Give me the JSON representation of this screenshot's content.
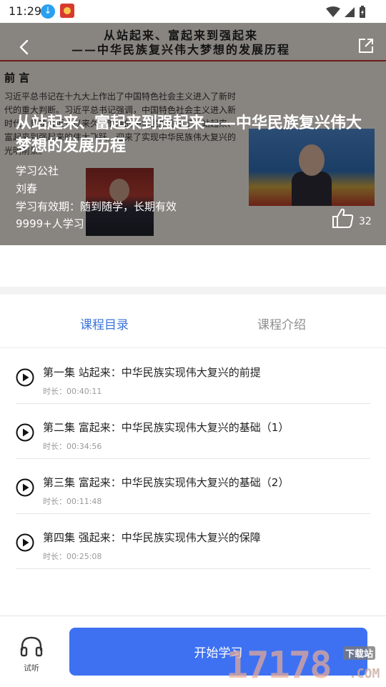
{
  "status_bar": {
    "time": "11:29"
  },
  "hero": {
    "doc_banner_line1": "从站起来、富起来到强起来",
    "doc_banner_line2": "——中华民族复兴伟大梦想的发展历程",
    "doc_heading": "前 言",
    "doc_text": "习近平总书记在十九大上作出了中国特色社会主义进入了新时代的重大判断。习近平总书记强调，中国特色社会主义进入新时代，意味着近代以来久经磨难的中华民族迎来了从站起来、富起来到强起来的伟大飞跃，迎来了实现中华民族伟大复兴的光明前景。",
    "title": "从站起来、富起来到强起来——中华民族复兴伟大梦想的发展历程",
    "publisher": "学习公社",
    "author": "刘春",
    "validity": "学习有效期：随到随学，长期有效",
    "learners": "9999+人学习",
    "likes": "32"
  },
  "tabs": [
    {
      "label": "课程目录",
      "active": true
    },
    {
      "label": "课程介绍",
      "active": false
    }
  ],
  "episodes": [
    {
      "title": "第一集 站起来：中华民族实现伟大复兴的前提",
      "duration": "时长：00:40:11"
    },
    {
      "title": "第二集 富起来：中华民族实现伟大复兴的基础（1）",
      "duration": "时长：00:34:56"
    },
    {
      "title": "第三集 富起来：中华民族实现伟大复兴的基础（2）",
      "duration": "时长：00:11:48"
    },
    {
      "title": "第四集 强起来：中华民族实现伟大复兴的保障",
      "duration": "时长：00:25:08"
    }
  ],
  "bottom": {
    "listen_label": "试听",
    "start_label": "开始学习"
  },
  "watermark": {
    "number": "17178",
    "tag": "下载站",
    "domain": ".COM"
  },
  "colors": {
    "accent": "#3b74d9",
    "button": "#3d71f2"
  }
}
